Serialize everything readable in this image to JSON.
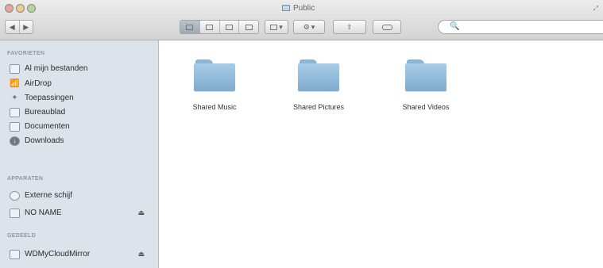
{
  "window": {
    "title": "Public"
  },
  "toolbar": {
    "nav": {
      "back": "◀",
      "forward": "▶"
    },
    "views": [
      "icon-view",
      "list-view",
      "column-view",
      "coverflow-view"
    ],
    "arrange": {
      "icon": "arrange-icon",
      "caret": "▾"
    },
    "action": {
      "icon": "gear-icon",
      "caret": "▾"
    },
    "share": {
      "icon": "share-icon"
    },
    "edit_tags": {
      "icon": "tag-icon"
    },
    "search": {
      "placeholder": "",
      "value": "",
      "icon": "🔍"
    }
  },
  "sidebar": {
    "sections": [
      {
        "title": "FAVORIETEN",
        "items": [
          {
            "label": "Al mijn bestanden",
            "icon": "all-files-icon"
          },
          {
            "label": "AirDrop",
            "icon": "airdrop-icon"
          },
          {
            "label": "Toepassingen",
            "icon": "applications-icon"
          },
          {
            "label": "Bureaublad",
            "icon": "desktop-icon"
          },
          {
            "label": "Documenten",
            "icon": "documents-icon"
          },
          {
            "label": "Downloads",
            "icon": "downloads-icon"
          }
        ]
      },
      {
        "title": "APPARATEN",
        "items": [
          {
            "label": "Externe schijf",
            "icon": "disk-icon"
          },
          {
            "label": "NO NAME",
            "icon": "drive-icon",
            "eject": "⏏"
          }
        ]
      },
      {
        "title": "GEDEELD",
        "items": [
          {
            "label": "WDMyCloudMirror",
            "icon": "network-drive-icon",
            "eject": "⏏"
          }
        ]
      }
    ]
  },
  "files": [
    {
      "name": "Shared Music"
    },
    {
      "name": "Shared Pictures"
    },
    {
      "name": "Shared Videos"
    }
  ]
}
